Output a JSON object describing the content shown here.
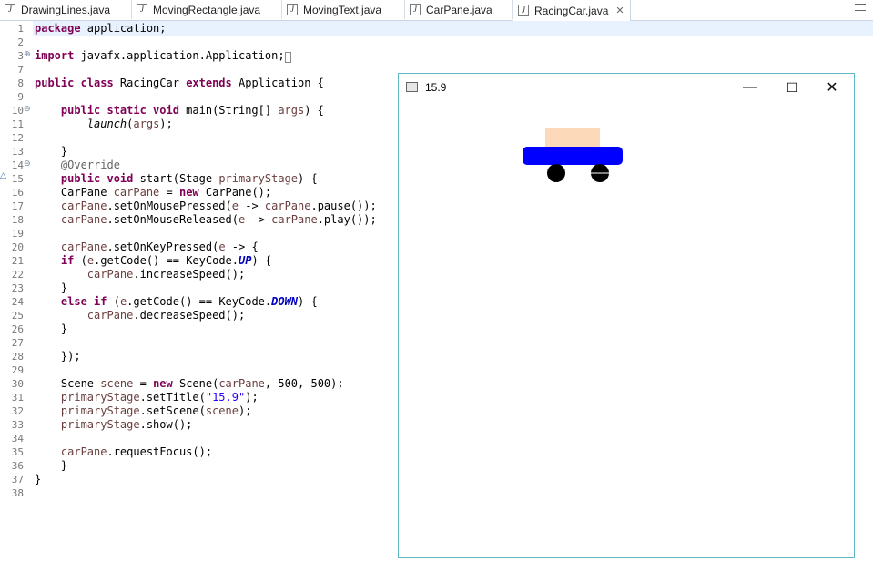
{
  "tabs": [
    {
      "label": "DrawingLines.java",
      "active": false
    },
    {
      "label": "MovingRectangle.java",
      "active": false
    },
    {
      "label": "MovingText.java",
      "active": false
    },
    {
      "label": "CarPane.java",
      "active": false
    },
    {
      "label": "RacingCar.java",
      "active": true
    }
  ],
  "line_numbers": [
    "1",
    "2",
    "3",
    "7",
    "8",
    "9",
    "10",
    "11",
    "12",
    "13",
    "14",
    "15",
    "16",
    "17",
    "18",
    "19",
    "20",
    "21",
    "22",
    "23",
    "24",
    "25",
    "26",
    "27",
    "28",
    "29",
    "30",
    "31",
    "32",
    "33",
    "34",
    "35",
    "36",
    "37",
    "38"
  ],
  "window": {
    "title": "15.9",
    "minimize_glyph": "—",
    "maximize_glyph": "☐",
    "close_glyph": "✕"
  },
  "colors": {
    "car_roof": "#fcd9b8",
    "car_body": "#0000ff",
    "car_wheels": "#000000",
    "window_border": "#5fb8c4"
  },
  "icons": {
    "java_file": "java-file-icon",
    "close_tab": "close-tab-icon"
  }
}
